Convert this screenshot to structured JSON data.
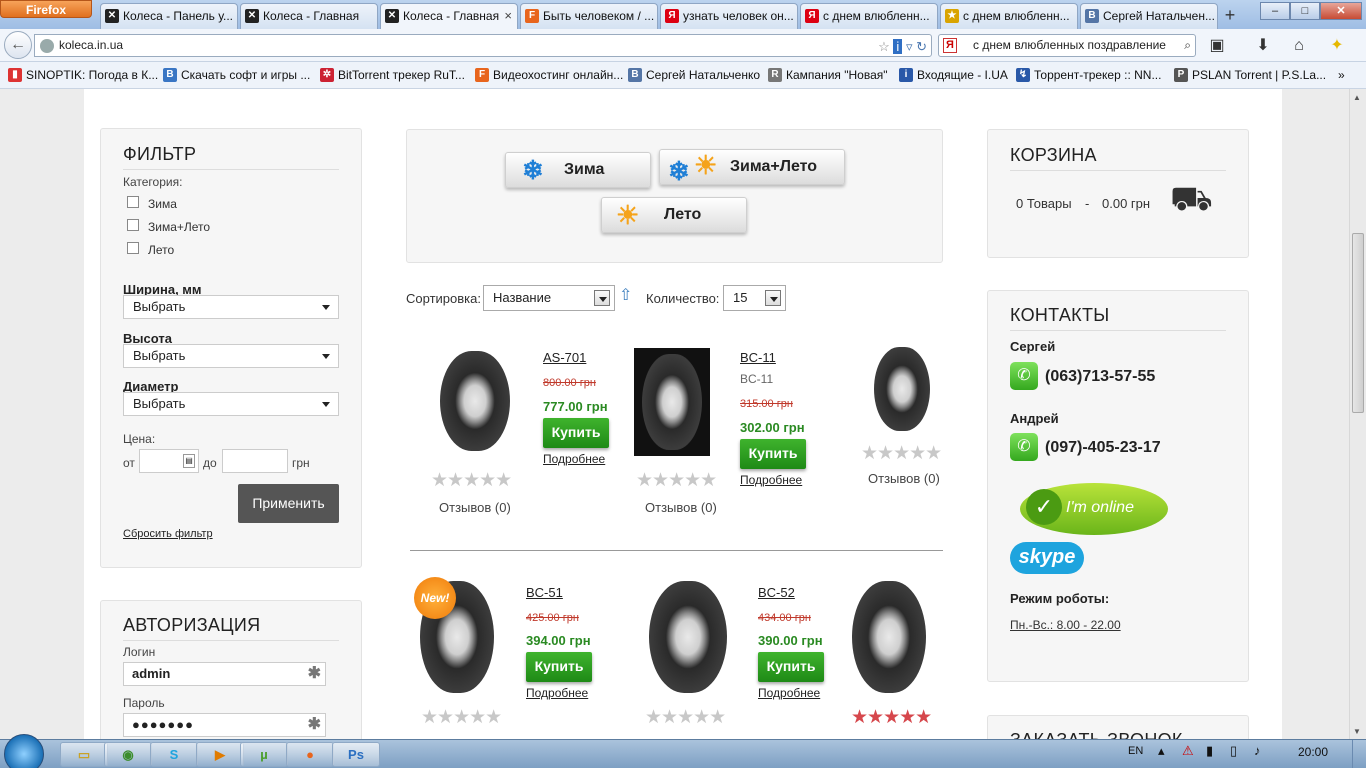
{
  "browser": {
    "menu_label": "Firefox",
    "tabs": [
      {
        "title": "Колеса - Панель у...",
        "icon": "site-logo",
        "color": "#c33"
      },
      {
        "title": "Колеса - Главная",
        "icon": "site-logo",
        "color": "#c33"
      },
      {
        "title": "Колеса - Главная",
        "icon": "site-logo",
        "color": "#c33",
        "active": true
      },
      {
        "title": "Быть человеком / ...",
        "icon": "F",
        "color": "#e8651d"
      },
      {
        "title": "узнать человек он...",
        "icon": "Я",
        "color": "#d01"
      },
      {
        "title": "с днем влюбленн...",
        "icon": "Я",
        "color": "#d01"
      },
      {
        "title": "с днем влюбленн...",
        "icon": "★",
        "color": "#d9a400"
      },
      {
        "title": "Сергей Натальчен...",
        "icon": "B",
        "color": "#5475a6"
      }
    ],
    "url": "koleca.in.ua",
    "search_text": "с днем влюбленных поздравление",
    "bookmarks": [
      {
        "label": "SINOPTIK: Погода в К...",
        "color": "#d33"
      },
      {
        "label": "Скачать софт и игры ...",
        "color": "#3a76c4"
      },
      {
        "label": "BitTorrent трекер RuT...",
        "color": "#c23"
      },
      {
        "label": "Видеохостинг онлайн...",
        "color": "#e8651d"
      },
      {
        "label": "Сергей Натальченко",
        "color": "#5475a6"
      },
      {
        "label": "Кампания \"Новая\"",
        "color": "#777"
      },
      {
        "label": "Входящие - I.UA",
        "color": "#2958a8"
      },
      {
        "label": "Торрент-трекер :: NN...",
        "color": "#2958a8"
      },
      {
        "label": "PSLAN Torrent | P.S.La...",
        "color": "#555"
      }
    ]
  },
  "filter": {
    "title": "ФИЛЬТР",
    "category_label": "Категория:",
    "categories": [
      "Зима",
      "Зима+Лето",
      "Лето"
    ],
    "width_label": "Ширина, мм",
    "height_label": "Высота",
    "diameter_label": "Диаметр",
    "select_value": "Выбрать",
    "price_label": "Цена:",
    "from_label": "от",
    "to_label": "до",
    "currency": "грн",
    "apply_label": "Применить",
    "reset_label": "Сбросить фильтр"
  },
  "auth": {
    "title": "АВТОРИЗАЦИЯ",
    "login_label": "Логин",
    "login_value": "admin",
    "password_label": "Пароль",
    "password_value": "●●●●●●●"
  },
  "seasons": {
    "winter": "Зима",
    "allseason": "Зима+Лето",
    "summer": "Лето"
  },
  "sorting": {
    "sort_label": "Сортировка:",
    "sort_value": "Название",
    "count_label": "Количество:",
    "count_value": "15"
  },
  "products": [
    {
      "name": "AS-701",
      "old_price": "800.00 грн",
      "price": "777.00 грн",
      "reviews": "Отзывов (0)",
      "rating": 0
    },
    {
      "name": "BC-11",
      "subtitle": "BC-11",
      "old_price": "315.00 грн",
      "price": "302.00 грн",
      "reviews": "Отзывов (0)",
      "rating": 0
    },
    {
      "reviews": "Отзывов (0)",
      "rating": 0
    },
    {
      "name": "BC-51",
      "old_price": "425.00 грн",
      "price": "394.00 грн",
      "badge": "New!",
      "rating": 0
    },
    {
      "name": "BC-52",
      "old_price": "434.00 грн",
      "price": "390.00 грн",
      "rating": 0
    },
    {
      "rating": 5
    }
  ],
  "buy_label": "Купить",
  "details_label": "Подробнее",
  "cart": {
    "title": "КОРЗИНА",
    "items": "0 Товары",
    "separator": "-",
    "total": "0.00 грн"
  },
  "contacts": {
    "title": "КОНТАКТЫ",
    "person1": "Сергей",
    "phone1": "(063)713-57-55",
    "person2": "Андрей",
    "phone2": "(097)-405-23-17",
    "online_label": "I'm online",
    "skype_label": "skype",
    "hours_label": "Режим роботы:",
    "hours_value": "Пн.-Вс.: 8.00 - 22.00"
  },
  "next_panel_title": "ЗАКАЗАТЬ ЗВОНОК",
  "taskbar": {
    "lang": "EN",
    "time": "20:00"
  }
}
